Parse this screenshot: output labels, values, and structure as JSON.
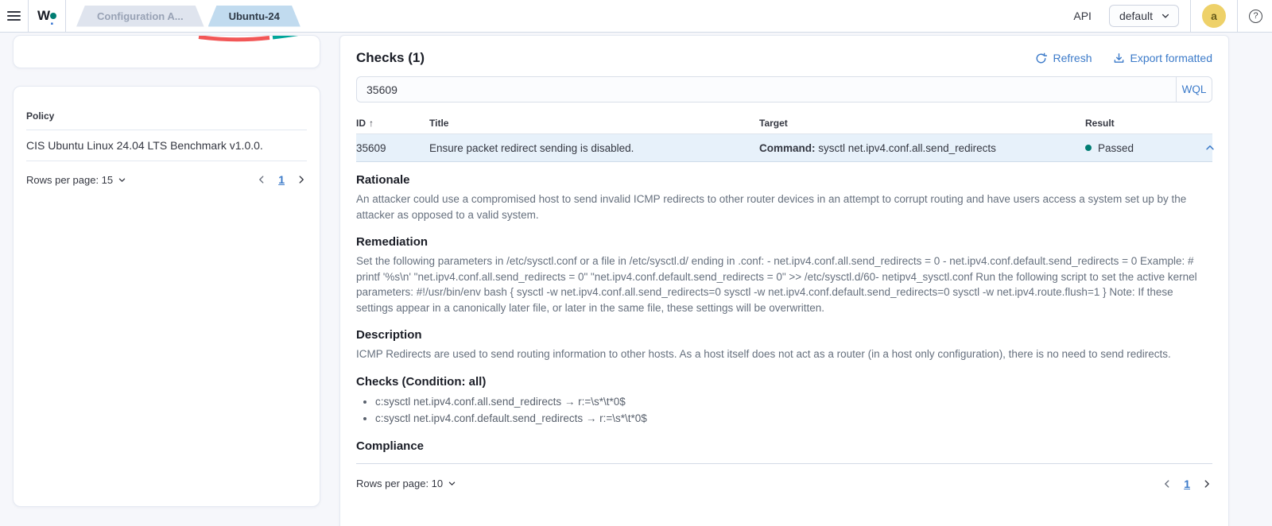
{
  "header": {
    "logo_text": "W",
    "logo_dot": ".",
    "tabs": [
      {
        "label": "Configuration A..."
      },
      {
        "label": "Ubuntu-24"
      }
    ],
    "api_label": "API",
    "api_host_value": "default",
    "avatar_initial": "a",
    "help_glyph": "?"
  },
  "sidebar": {
    "policy_header": "Policy",
    "policy_name": "CIS Ubuntu Linux 24.04 LTS Benchmark v1.0.0.",
    "rows_per_page_label": "Rows per page: 15",
    "page_number": "1"
  },
  "checks": {
    "title": "Checks (1)",
    "refresh_label": "Refresh",
    "export_label": "Export formatted",
    "search_value": "35609",
    "wql_label": "WQL",
    "columns": [
      "ID",
      "Title",
      "Target",
      "Result"
    ],
    "sort_icon": "↑",
    "row": {
      "id": "35609",
      "title": "Ensure packet redirect sending is disabled.",
      "target_label": "Command:",
      "target_value": " sysctl net.ipv4.conf.all.send_redirects",
      "result": "Passed"
    },
    "details": {
      "rationale_title": "Rationale",
      "rationale_text": "An attacker could use a compromised host to send invalid ICMP redirects to other router devices in an attempt to corrupt routing and have users access a system set up by the attacker as opposed to a valid system.",
      "remediation_title": "Remediation",
      "remediation_text": "Set the following parameters in /etc/sysctl.conf or a file in /etc/sysctl.d/ ending in .conf: - net.ipv4.conf.all.send_redirects = 0 - net.ipv4.conf.default.send_redirects = 0 Example: # printf '%s\\n' \"net.ipv4.conf.all.send_redirects = 0\" \"net.ipv4.conf.default.send_redirects = 0\" >> /etc/sysctl.d/60- netipv4_sysctl.conf Run the following script to set the active kernel parameters: #!/usr/bin/env bash { sysctl -w net.ipv4.conf.all.send_redirects=0 sysctl -w net.ipv4.conf.default.send_redirects=0 sysctl -w net.ipv4.route.flush=1 } Note: If these settings appear in a canonically later file, or later in the same file, these settings will be overwritten.",
      "description_title": "Description",
      "description_text": "ICMP Redirects are used to send routing information to other hosts. As a host itself does not act as a router (in a host only configuration), there is no need to send redirects.",
      "checks_title": "Checks (Condition: all)",
      "check_items": [
        "c:sysctl net.ipv4.conf.all.send_redirects → r:=\\s*\\t*0$",
        "c:sysctl net.ipv4.conf.default.send_redirects → r:=\\s*\\t*0$"
      ],
      "compliance_title": "Compliance"
    },
    "footer": {
      "rows_per_page_label": "Rows per page: 10",
      "page_number": "1"
    }
  },
  "colors": {
    "accent_blue": "#3b7ac9",
    "passed_green": "#017d73",
    "active_tab_bg": "#c1dbef",
    "inactive_tab_bg": "#dfe4ee",
    "selected_row_bg": "#e7f1fa",
    "avatar_bg": "#eed169",
    "pie_red": "#f25757",
    "pie_teal": "#00a69a"
  }
}
